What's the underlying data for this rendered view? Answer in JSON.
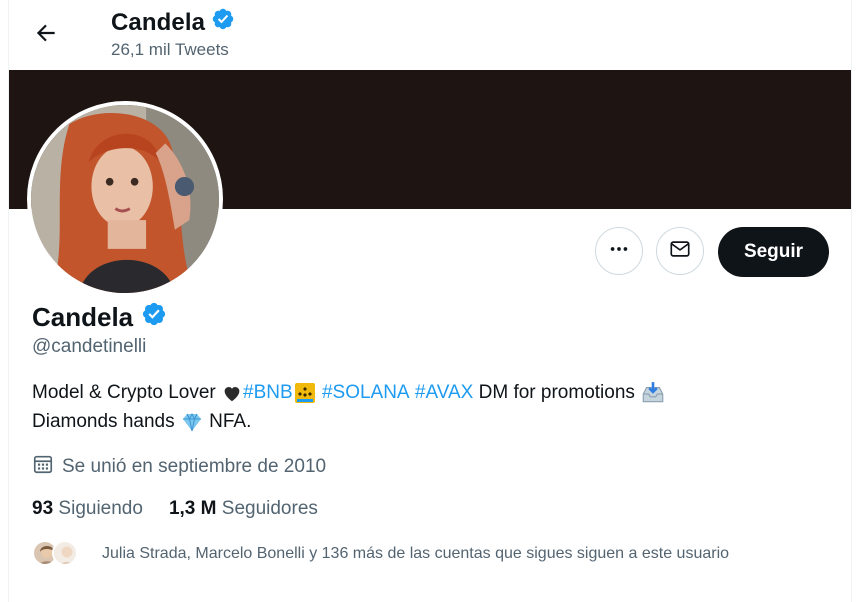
{
  "header": {
    "name": "Candela",
    "tweet_count": "26,1 mil Tweets"
  },
  "profile": {
    "name": "Candela",
    "handle": "@candetinelli",
    "bio_line1": {
      "text1": "Model & Crypto Lover",
      "tag_bnb": "#BNB",
      "tag_solana": "#SOLANA",
      "tag_avax": "#AVAX",
      "text2": "DM for promotions"
    },
    "bio_line2": {
      "text1": "Diamonds hands",
      "text2": "NFA."
    },
    "joined": "Se unió en septiembre de 2010",
    "following_count": "93",
    "following_label": "Siguiendo",
    "followers_count": "1,3 M",
    "followers_label": "Seguidores",
    "followers_you_know": "Julia Strada, Marcelo Bonelli y 136 más de las cuentas que sigues siguen a este usuario"
  },
  "actions": {
    "follow_label": "Seguir"
  },
  "colors": {
    "accent": "#1d9bf0",
    "text": "#0f1419",
    "muted": "#536471",
    "banner": "#1e1412",
    "verified": "#1d9bf0"
  },
  "icons": [
    "back-arrow-icon",
    "verified-badge-icon",
    "more-icon",
    "message-icon",
    "calendar-icon",
    "black-heart-emoji",
    "bnb-logo-emoji",
    "inbox-tray-emoji",
    "diamond-emoji"
  ]
}
